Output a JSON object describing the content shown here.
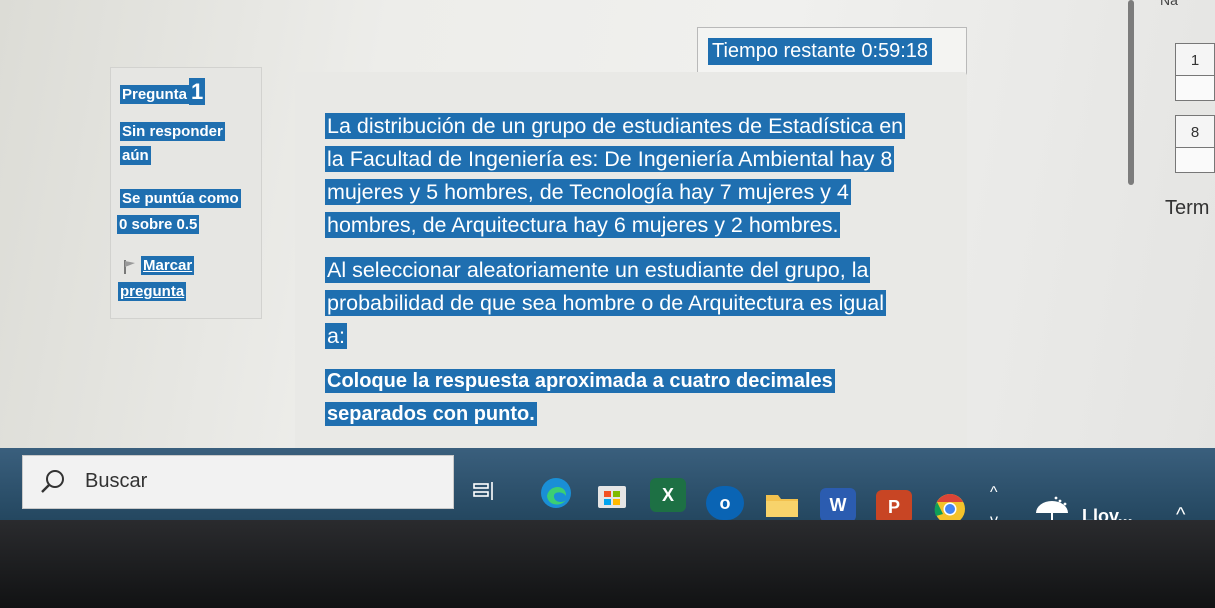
{
  "timer": {
    "label": "Tiempo restante 0:59:18"
  },
  "nav": {
    "top_fragment": "Na",
    "boxes": [
      "1",
      "8"
    ],
    "finish_label": "Term"
  },
  "info": {
    "question_label": "Pregunta",
    "question_number": "1",
    "status_line1": "Sin responder",
    "status_line2": "aún",
    "score_line1": "Se puntúa como",
    "score_line2": "0 sobre 0.5",
    "flag_line1": "Marcar",
    "flag_line2": "pregunta"
  },
  "question": {
    "paragraph1": [
      "La distribución de un grupo de estudiantes de Estadística en",
      "la Facultad de Ingeniería es: De Ingeniería Ambiental hay 8",
      "mujeres y 5 hombres, de Tecnología hay 7 mujeres y 4",
      "hombres, de Arquitectura hay 6 mujeres y 2 hombres."
    ],
    "paragraph2": [
      "Al seleccionar aleatoriamente un estudiante del grupo, la",
      "probabilidad de que sea hombre o de Arquitectura es igual",
      "a:"
    ],
    "instruction": [
      "Coloque la respuesta aproximada a cuatro decimales",
      "separados con punto."
    ]
  },
  "taskbar": {
    "search_placeholder": "Buscar",
    "weather_label": "Llov...",
    "icons": [
      "task-view-icon",
      "edge-icon",
      "store-icon",
      "excel-icon",
      "outlook-icon",
      "file-explorer-icon",
      "word-icon",
      "powerpoint-icon",
      "chrome-icon"
    ]
  },
  "colors": {
    "highlight": "#1f6fb0",
    "taskbar": "#2e5470"
  }
}
